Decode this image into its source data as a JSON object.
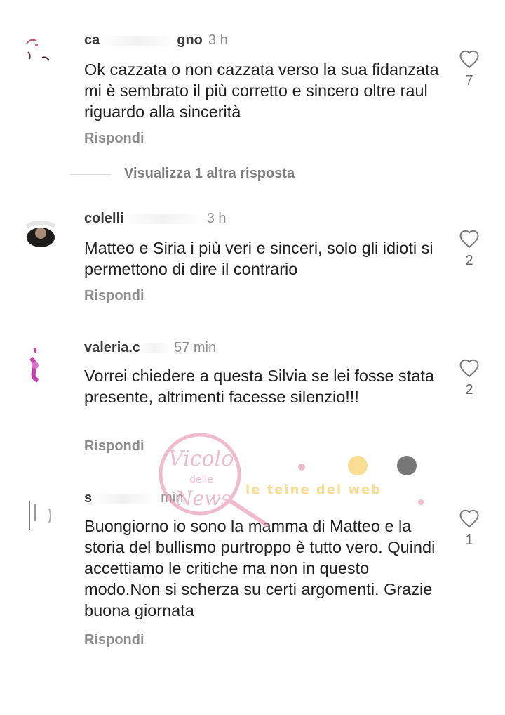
{
  "comments": [
    {
      "username": "ca",
      "username_tail": "gno",
      "time": "3 h",
      "text": "Ok cazzata o non cazzata verso la sua fidanzata mi è sembrato il più corretto e sincero oltre raul riguardo alla sincerità",
      "reply_label": "Rispondi",
      "likes": "7"
    },
    {
      "username": "colelli",
      "username_tail": "",
      "time": "3 h",
      "text": "Matteo e Siria i più veri e sinceri, solo gli idioti si permettono di dire il contrario",
      "reply_label": "Rispondi",
      "likes": "2"
    },
    {
      "username": "valeria.c",
      "username_tail": "",
      "time": "57 min",
      "text": "Vorrei chiedere a questa Silvia se lei fosse stata presente, altrimenti facesse silenzio!!!",
      "reply_label": "Rispondi",
      "likes": "2"
    },
    {
      "username": "s",
      "username_tail": "",
      "time": "min",
      "text": "Buongiorno io sono la mamma di Matteo e la storia del bullismo purtroppo è tutto vero. Quindi accettiamo le critiche ma non in questo modo.Non si scherza su certi argomenti. Grazie buona giornata",
      "reply_label": "Rispondi",
      "likes": "1"
    }
  ],
  "view_more": "Visualizza 1 altra risposta",
  "watermark": {
    "text1": "Vicolo",
    "text2": "delle",
    "text3": "News",
    "text4": "le teine del web"
  },
  "colors": {
    "meta": "#8e8e8e",
    "text": "#202020",
    "heart": "#7a7a7a",
    "watermark_pink": "#e88fb0",
    "watermark_yellow": "#f5c84a"
  },
  "icons": [
    "heart-outline-icon",
    "avatar"
  ]
}
